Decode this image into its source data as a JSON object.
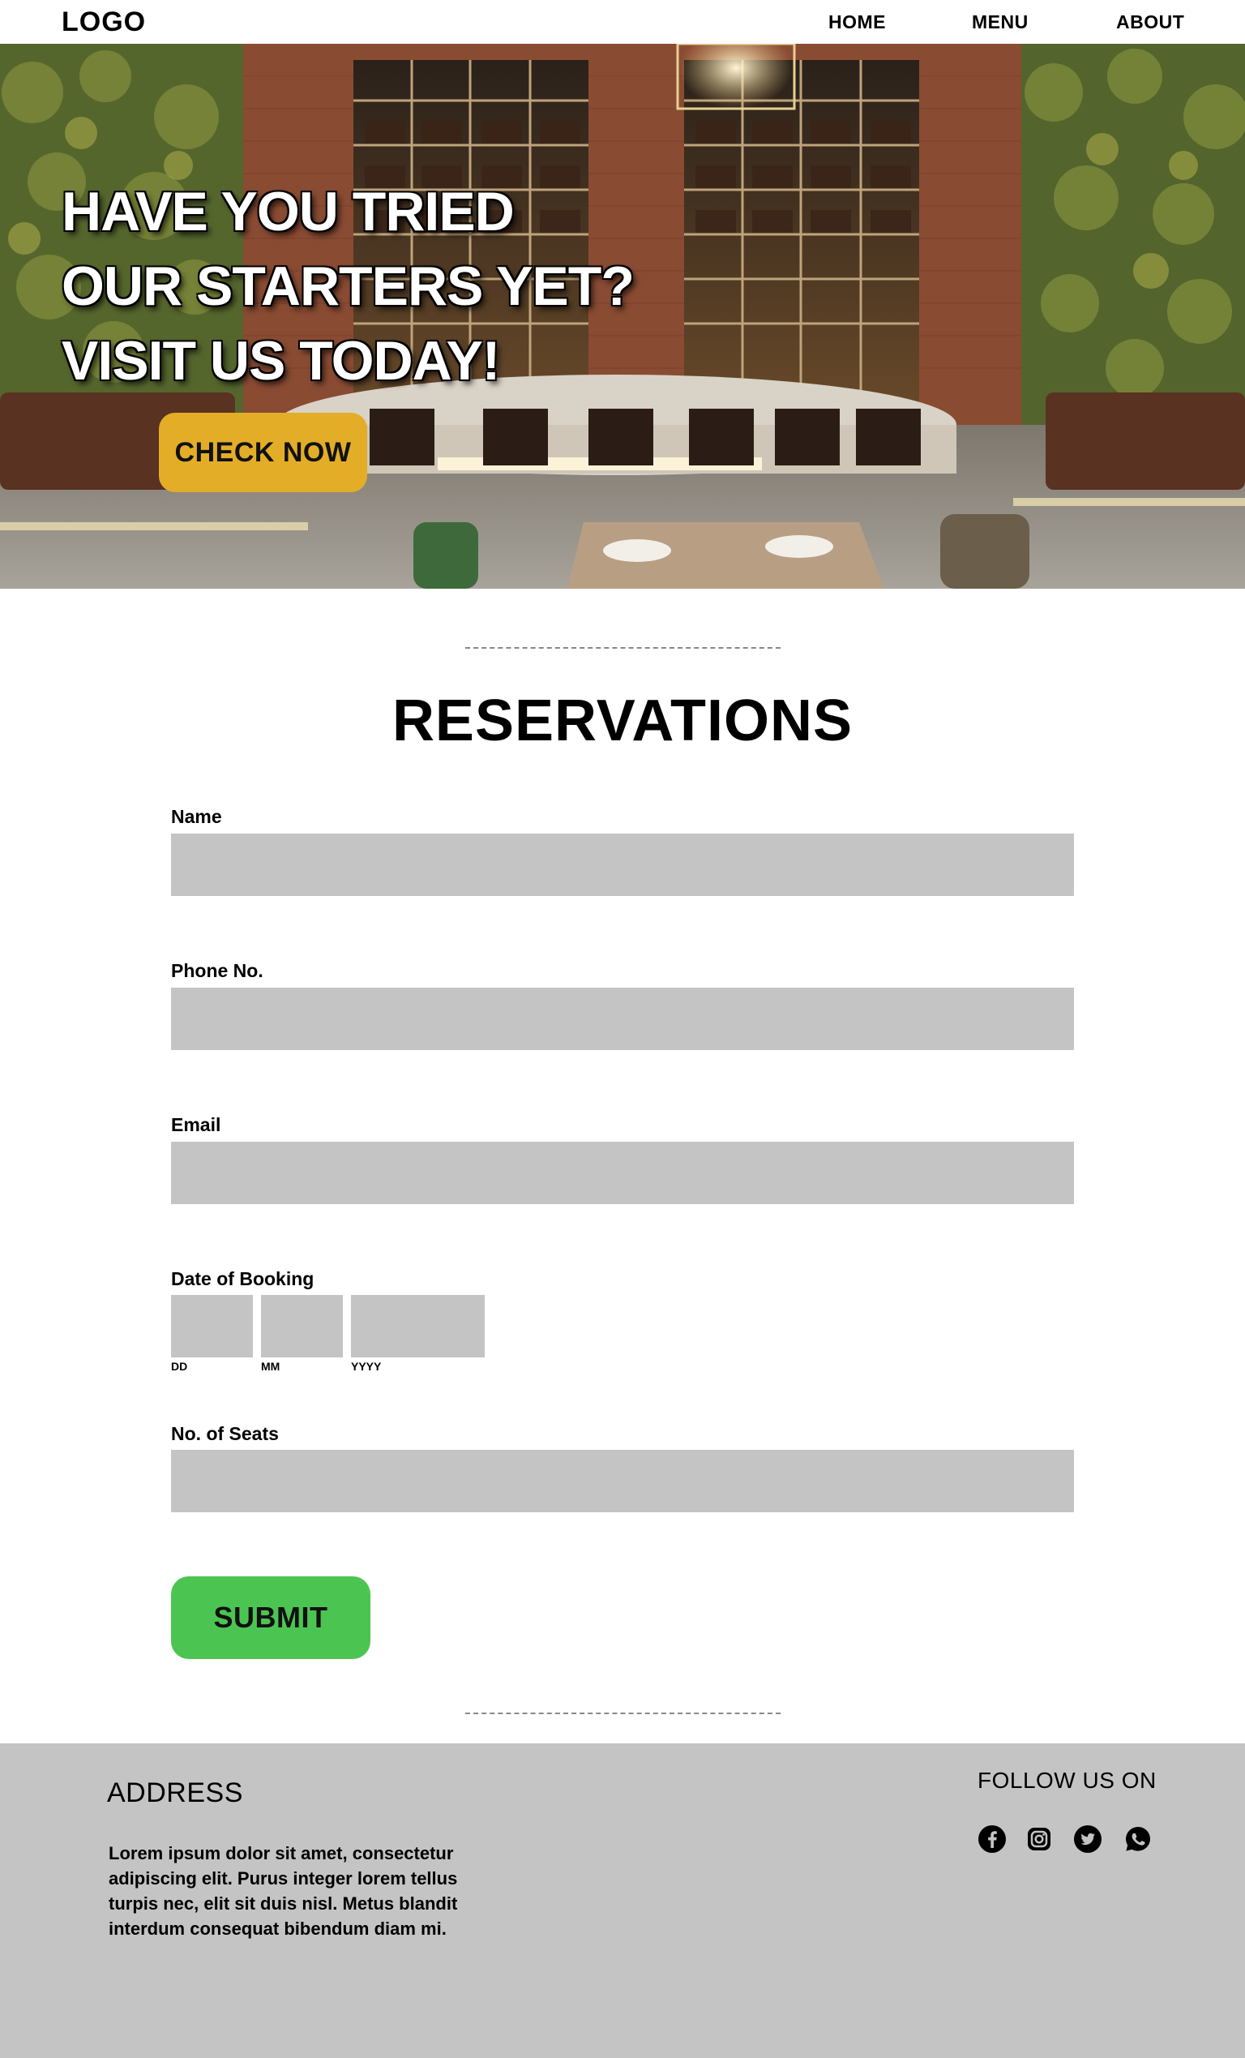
{
  "nav": {
    "logo": "LOGO",
    "links": [
      {
        "label": "HOME"
      },
      {
        "label": "MENU"
      },
      {
        "label": "ABOUT"
      }
    ]
  },
  "hero": {
    "lines": [
      "HAVE YOU TRIED",
      "OUR STARTERS YET?",
      "VISIT US TODAY!"
    ],
    "button_label": "CHECK NOW",
    "button_color": "#e3ad27"
  },
  "reservations": {
    "title": "RESERVATIONS",
    "fields": {
      "name": {
        "label": "Name",
        "value": ""
      },
      "phone": {
        "label": "Phone No.",
        "value": ""
      },
      "email": {
        "label": "Email",
        "value": ""
      },
      "date": {
        "label": "Date of Booking",
        "dd": "DD",
        "mm": "MM",
        "yyyy": "YYYY"
      },
      "seats": {
        "label": "No. of Seats",
        "value": ""
      }
    },
    "submit_label": "SUBMIT",
    "submit_color": "#4cc452",
    "input_color": "#c4c4c4"
  },
  "footer": {
    "address_title": "ADDRESS",
    "address_text": "Lorem ipsum dolor sit amet, consectetur adipiscing elit. Purus integer lorem tellus turpis nec, elit sit duis nisl. Metus blandit interdum consequat bibendum diam mi.",
    "follow_title": "FOLLOW US ON",
    "social_icons": [
      "facebook-icon",
      "instagram-icon",
      "twitter-icon",
      "whatsapp-icon"
    ],
    "background": "#c4c4c4"
  }
}
